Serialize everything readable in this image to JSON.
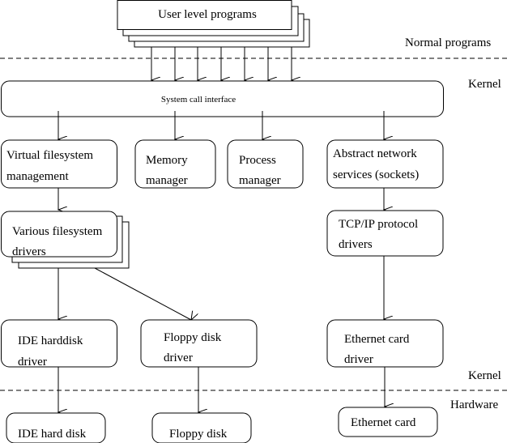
{
  "layers": {
    "normal_programs": "Normal programs",
    "kernel_top": "Kernel",
    "kernel_bottom": "Kernel",
    "hardware": "Hardware"
  },
  "nodes": {
    "user_programs": "User level programs",
    "syscall": "System call interface",
    "vfs": [
      "Virtual filesystem",
      "management"
    ],
    "memory": [
      "Memory",
      "manager"
    ],
    "process": [
      "Process",
      "manager"
    ],
    "net": [
      "Abstract network",
      "services (sockets)"
    ],
    "fs_drivers": [
      "Various filesystem",
      "drivers"
    ],
    "tcpip": [
      "TCP/IP protocol",
      "drivers"
    ],
    "ide_driver": [
      "IDE harddisk",
      "driver"
    ],
    "floppy_driver": [
      "Floppy disk",
      "driver"
    ],
    "eth_driver": [
      "Ethernet card",
      "driver"
    ],
    "ide_disk": "IDE hard disk",
    "floppy_disk": "Floppy disk",
    "eth_card": "Ethernet card"
  }
}
